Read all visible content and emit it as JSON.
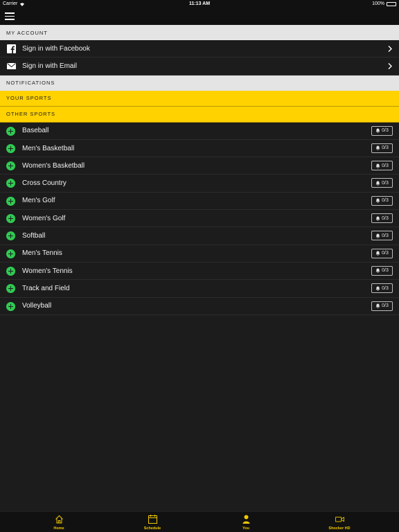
{
  "status_bar": {
    "carrier": "Carrier",
    "time": "11:13 AM",
    "battery": "100%"
  },
  "account": {
    "header": "MY ACCOUNT",
    "items": [
      {
        "label": "Sign in with Facebook",
        "icon": "facebook-icon"
      },
      {
        "label": "Sign in with Email",
        "icon": "email-icon"
      }
    ]
  },
  "notifications": {
    "header": "NOTIFICATIONS"
  },
  "your_sports": {
    "header": "YOUR SPORTS"
  },
  "other_sports": {
    "header": "OTHER SPORTS",
    "items": [
      {
        "label": "Baseball",
        "count": "0/3"
      },
      {
        "label": "Men's Basketball",
        "count": "0/3"
      },
      {
        "label": "Women's Basketball",
        "count": "0/3"
      },
      {
        "label": "Cross Country",
        "count": "0/3"
      },
      {
        "label": "Men's Golf",
        "count": "0/3"
      },
      {
        "label": "Women's Golf",
        "count": "0/3"
      },
      {
        "label": "Softball",
        "count": "0/3"
      },
      {
        "label": "Men's Tennis",
        "count": "0/3"
      },
      {
        "label": "Women's Tennis",
        "count": "0/3"
      },
      {
        "label": "Track and Field",
        "count": "0/3"
      },
      {
        "label": "Volleyball",
        "count": "0/3"
      }
    ]
  },
  "tab_bar": {
    "tabs": [
      {
        "label": "Home",
        "icon": "home-icon"
      },
      {
        "label": "Schedule",
        "icon": "calendar-icon"
      },
      {
        "label": "You",
        "icon": "user-icon"
      },
      {
        "label": "Shocker HD",
        "icon": "video-camera-icon"
      }
    ]
  },
  "colors": {
    "background": "#1c1c1c",
    "accent_yellow": "#ffd200",
    "header_gray": "#e4e4e4",
    "add_green": "#2ecc52",
    "tab_label": "#f0c800"
  }
}
